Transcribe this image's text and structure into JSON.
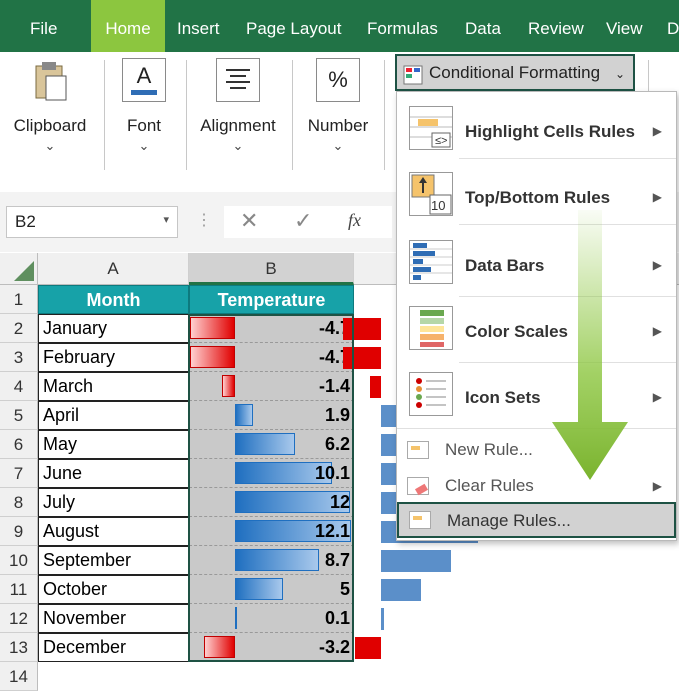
{
  "tabs": [
    "File",
    "Home",
    "Insert",
    "Page Layout",
    "Formulas",
    "Data",
    "Review",
    "View",
    "D"
  ],
  "active_tab": "Home",
  "ribbon": {
    "groups": [
      {
        "label": "Clipboard",
        "icon": "clipboard-icon"
      },
      {
        "label": "Font",
        "icon": "font-icon"
      },
      {
        "label": "Alignment",
        "icon": "alignment-icon"
      },
      {
        "label": "Number",
        "icon": "percent-icon",
        "glyph": "%"
      }
    ],
    "font_glyph": "A",
    "conditional_formatting": "Conditional Formatting"
  },
  "formula_bar": {
    "name_box": "B2",
    "fx": "fx"
  },
  "columns": [
    "A",
    "B"
  ],
  "header_row": {
    "month": "Month",
    "temperature": "Temperature"
  },
  "rows": [
    {
      "n": "1"
    },
    {
      "n": "2",
      "month": "January",
      "value": "-4.7",
      "v": -4.7
    },
    {
      "n": "3",
      "month": "February",
      "value": "-4.7",
      "v": -4.7
    },
    {
      "n": "4",
      "month": "March",
      "value": "-1.4",
      "v": -1.4
    },
    {
      "n": "5",
      "month": "April",
      "value": "1.9",
      "v": 1.9
    },
    {
      "n": "6",
      "month": "May",
      "value": "6.2",
      "v": 6.2
    },
    {
      "n": "7",
      "month": "June",
      "value": "10.1",
      "v": 10.1
    },
    {
      "n": "8",
      "month": "July",
      "value": "12",
      "v": 12
    },
    {
      "n": "9",
      "month": "August",
      "value": "12.1",
      "v": 12.1
    },
    {
      "n": "10",
      "month": "September",
      "value": "8.7",
      "v": 8.7
    },
    {
      "n": "11",
      "month": "October",
      "value": "5",
      "v": 5
    },
    {
      "n": "12",
      "month": "November",
      "value": "0.1",
      "v": 0.1
    },
    {
      "n": "13",
      "month": "December",
      "value": "-3.2",
      "v": -3.2
    },
    {
      "n": "14"
    }
  ],
  "menu": {
    "items": [
      {
        "label": "Highlight Cells Rules",
        "icon": "highlight-cells-icon",
        "submenu": true
      },
      {
        "label": "Top/Bottom Rules",
        "icon": "top-bottom-icon",
        "submenu": true,
        "glyph": "10"
      },
      {
        "label": "Data Bars",
        "icon": "data-bars-icon",
        "submenu": true
      },
      {
        "label": "Color Scales",
        "icon": "color-scales-icon",
        "submenu": true
      },
      {
        "label": "Icon Sets",
        "icon": "icon-sets-icon",
        "submenu": true
      }
    ],
    "small_items": [
      {
        "label": "New Rule...",
        "icon": "new-rule-icon"
      },
      {
        "label": "Clear Rules",
        "icon": "clear-rules-icon",
        "submenu": true
      },
      {
        "label": "Manage Rules...",
        "icon": "manage-rules-icon"
      }
    ]
  },
  "colors": {
    "ribbon_green": "#217346",
    "active_tab": "#8cc63f",
    "header_teal": "#17a2a8",
    "negative_bar": "#e00000",
    "positive_bar": "#1f6fc0",
    "arrow_green": "#8cc63f"
  }
}
